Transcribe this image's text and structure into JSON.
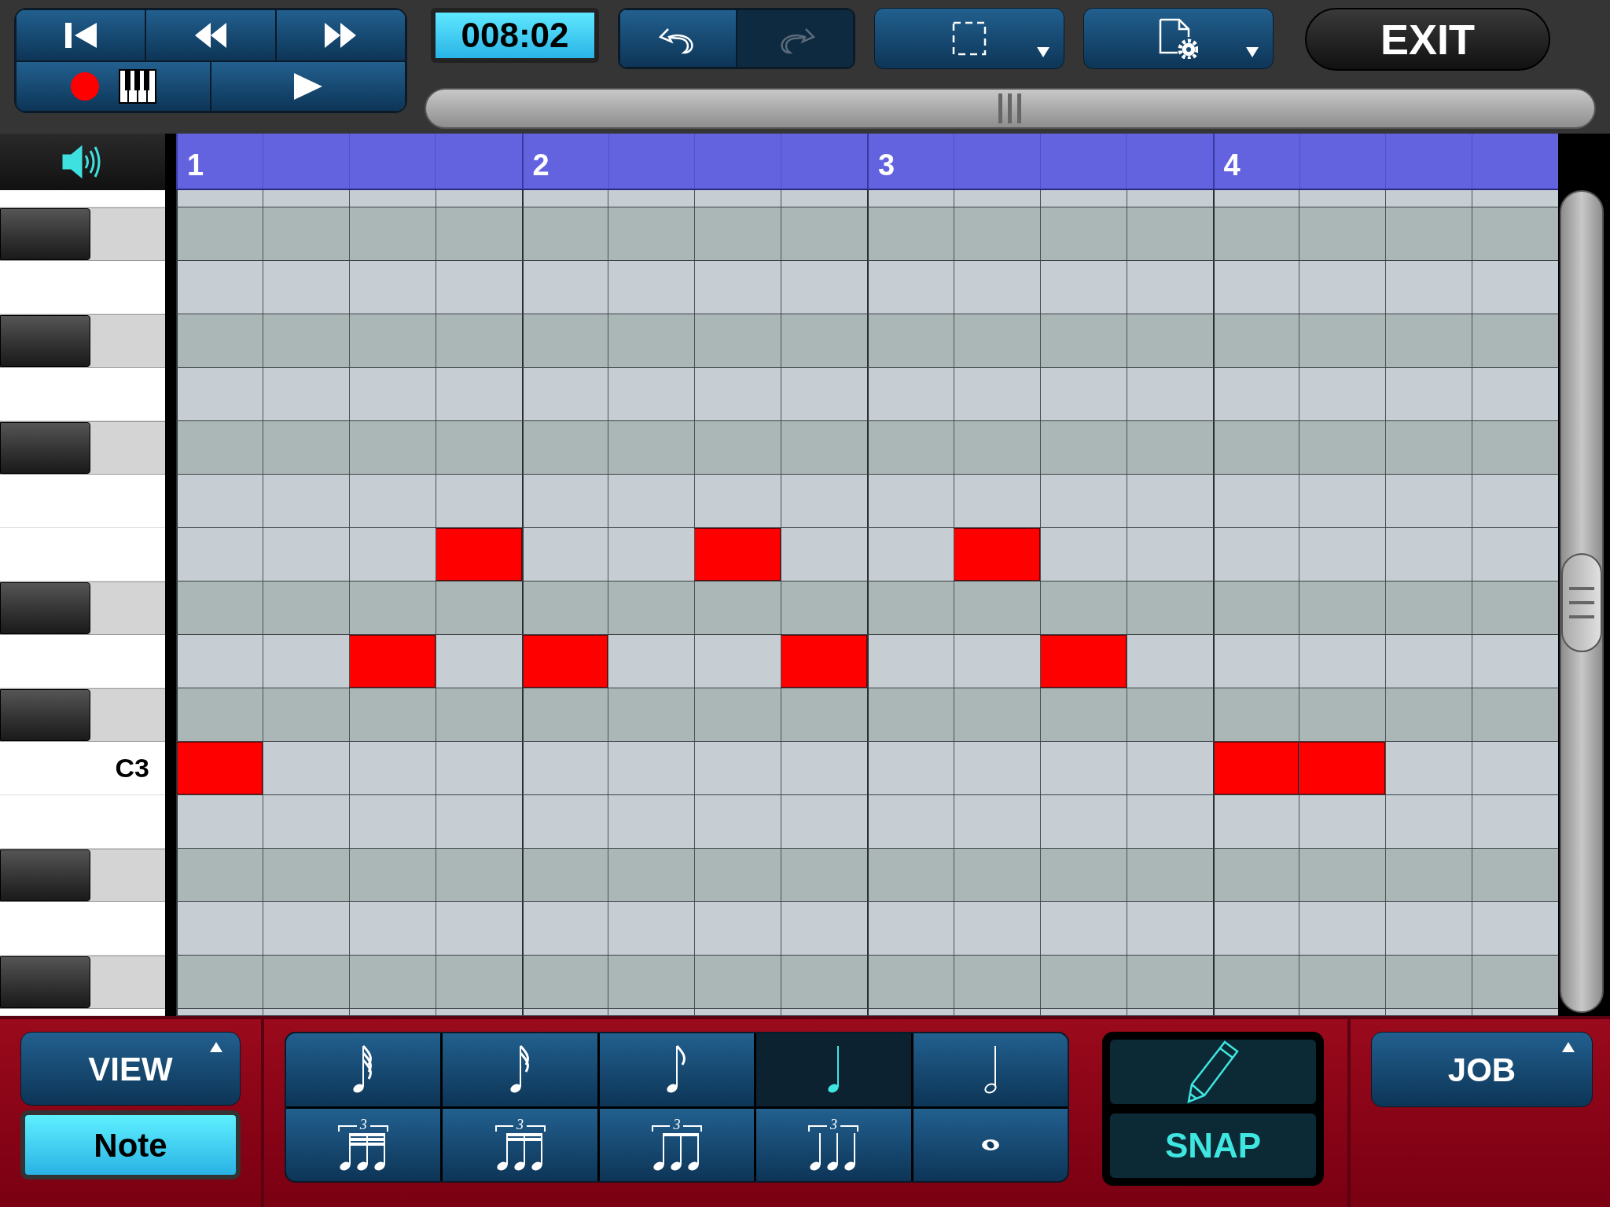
{
  "transport": {
    "top": [
      {
        "kind": "to-start"
      },
      {
        "kind": "rewind"
      },
      {
        "kind": "fast-forward"
      }
    ],
    "record": {
      "on": true
    },
    "play": {
      "kind": "play"
    }
  },
  "time": "008:02",
  "history": [
    {
      "kind": "undo",
      "disabled": false
    },
    {
      "kind": "redo",
      "disabled": true
    }
  ],
  "tools": [
    {
      "kind": "select"
    },
    {
      "kind": "file-settings"
    }
  ],
  "exit": "EXIT",
  "bars": [
    "1",
    "2",
    "3",
    "4"
  ],
  "rows": [
    {
      "kind": "white",
      "cells": [
        false,
        false,
        false,
        false,
        false,
        false,
        false,
        false,
        false,
        false,
        false,
        false,
        false,
        false,
        false,
        false
      ]
    },
    {
      "kind": "black",
      "cells": [
        false,
        false,
        false,
        false,
        false,
        false,
        false,
        false,
        false,
        false,
        false,
        false,
        false,
        false,
        false,
        false
      ]
    },
    {
      "kind": "white",
      "cells": [
        false,
        false,
        false,
        false,
        false,
        false,
        false,
        false,
        false,
        false,
        false,
        false,
        false,
        false,
        false,
        false
      ]
    },
    {
      "kind": "black",
      "cells": [
        false,
        false,
        false,
        false,
        false,
        false,
        false,
        false,
        false,
        false,
        false,
        false,
        false,
        false,
        false,
        false
      ]
    },
    {
      "kind": "white",
      "cells": [
        false,
        false,
        false,
        false,
        false,
        false,
        false,
        false,
        false,
        false,
        false,
        false,
        false,
        false,
        false,
        false
      ]
    },
    {
      "kind": "black",
      "cells": [
        false,
        false,
        false,
        false,
        false,
        false,
        false,
        false,
        false,
        false,
        false,
        false,
        false,
        false,
        false,
        false
      ]
    },
    {
      "kind": "white",
      "cells": [
        false,
        false,
        false,
        false,
        false,
        false,
        false,
        false,
        false,
        false,
        false,
        false,
        false,
        false,
        false,
        false
      ]
    },
    {
      "kind": "white",
      "cells": [
        false,
        false,
        false,
        true,
        false,
        false,
        true,
        false,
        false,
        true,
        false,
        false,
        false,
        false,
        false,
        false
      ]
    },
    {
      "kind": "black",
      "cells": [
        false,
        false,
        false,
        false,
        false,
        false,
        false,
        false,
        false,
        false,
        false,
        false,
        false,
        false,
        false,
        false
      ]
    },
    {
      "kind": "white",
      "cells": [
        false,
        false,
        true,
        false,
        true,
        false,
        false,
        true,
        false,
        false,
        true,
        false,
        false,
        false,
        false,
        false
      ]
    },
    {
      "kind": "black",
      "cells": [
        false,
        false,
        false,
        false,
        false,
        false,
        false,
        false,
        false,
        false,
        false,
        false,
        false,
        false,
        false,
        false
      ]
    },
    {
      "kind": "white",
      "label": "C3",
      "cells": [
        true,
        false,
        false,
        false,
        false,
        false,
        false,
        false,
        false,
        false,
        false,
        false,
        true,
        true,
        false,
        false
      ]
    },
    {
      "kind": "white",
      "cells": [
        false,
        false,
        false,
        false,
        false,
        false,
        false,
        false,
        false,
        false,
        false,
        false,
        false,
        false,
        false,
        false
      ]
    },
    {
      "kind": "black",
      "cells": [
        false,
        false,
        false,
        false,
        false,
        false,
        false,
        false,
        false,
        false,
        false,
        false,
        false,
        false,
        false,
        false
      ]
    },
    {
      "kind": "white",
      "cells": [
        false,
        false,
        false,
        false,
        false,
        false,
        false,
        false,
        false,
        false,
        false,
        false,
        false,
        false,
        false,
        false
      ]
    },
    {
      "kind": "black",
      "cells": [
        false,
        false,
        false,
        false,
        false,
        false,
        false,
        false,
        false,
        false,
        false,
        false,
        false,
        false,
        false,
        false
      ]
    },
    {
      "kind": "white",
      "cells": [
        false,
        false,
        false,
        false,
        false,
        false,
        false,
        false,
        false,
        false,
        false,
        false,
        false,
        false,
        false,
        false
      ]
    }
  ],
  "view": {
    "label": "VIEW",
    "mode": "Note",
    "mode_selected": true
  },
  "note_values": [
    {
      "kind": "thirty-second",
      "selected": false
    },
    {
      "kind": "sixteenth",
      "selected": false
    },
    {
      "kind": "eighth",
      "selected": false
    },
    {
      "kind": "quarter",
      "selected": true
    },
    {
      "kind": "half",
      "selected": false
    },
    {
      "kind": "triplet-thirty-second",
      "triplet": "3",
      "selected": false
    },
    {
      "kind": "triplet-sixteenth",
      "triplet": "3",
      "selected": false
    },
    {
      "kind": "triplet-eighth",
      "triplet": "3",
      "selected": false
    },
    {
      "kind": "triplet-quarter",
      "triplet": "3",
      "selected": false
    },
    {
      "kind": "whole",
      "selected": false
    }
  ],
  "pencil": {
    "on": true
  },
  "snap": {
    "label": "SNAP",
    "on": true
  },
  "job": "JOB"
}
